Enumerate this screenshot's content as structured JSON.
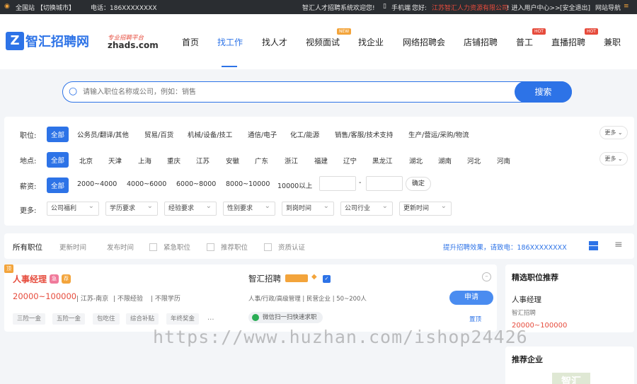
{
  "topbar": {
    "site": "全国站",
    "switch": "【切换城市】",
    "phone": "电话：186XXXXXXXX",
    "welcome": "智汇人才招聘系统欢迎您!",
    "mobile": "手机端",
    "hello": "您好:",
    "company": "江苏智汇人力资源有限公司",
    "enter": "! 进入用户中心>>",
    "logout": "[安全退出]",
    "sitenav": "网站导航"
  },
  "logo": {
    "main": "智汇招聘网",
    "slogan": "专业招聘平台",
    "domain": "zhads.com"
  },
  "nav": {
    "items": [
      "首页",
      "找工作",
      "找人才",
      "视频面试",
      "找企业",
      "网络招聘会",
      "店铺招聘",
      "普工",
      "直播招聘",
      "兼职"
    ],
    "new_badge": "NEW",
    "hot_badge": "HOT"
  },
  "search": {
    "placeholder": "请输入职位名称或公司，例如：销售",
    "button": "搜索"
  },
  "filters": {
    "job_label": "职位:",
    "all": "全部",
    "jobs": [
      "公务员/翻译/其他",
      "贸易/百货",
      "机械/设备/技工",
      "通信/电子",
      "化工/能源",
      "销售/客服/技术支持",
      "生产/营运/采购/物流"
    ],
    "more": "更多",
    "area_label": "地点:",
    "areas": [
      "北京",
      "天津",
      "上海",
      "重庆",
      "江苏",
      "安徽",
      "广东",
      "浙江",
      "福建",
      "辽宁",
      "黑龙江",
      "湖北",
      "湖南",
      "河北",
      "河南"
    ],
    "salary_label": "薪资:",
    "salaries": [
      "2000~4000",
      "4000~6000",
      "6000~8000",
      "8000~10000",
      "10000以上"
    ],
    "dash": "-",
    "confirm": "确定",
    "more_label": "更多:",
    "selects": [
      "公司福利",
      "学历要求",
      "经验要求",
      "性别要求",
      "到岗时间",
      "公司行业",
      "更新时间"
    ]
  },
  "tabs": {
    "all": "所有职位",
    "update": "更新时间",
    "publish": "发布时间",
    "urgent": "紧急职位",
    "recommend": "推荐职位",
    "verified": "资质认证",
    "promo": "提升招聘效果，请致电：186XXXXXXXX"
  },
  "job": {
    "corner": "顶",
    "title": "人事经理",
    "salary": "20000~100000",
    "location": "江苏-南京",
    "exp": "不限经验",
    "edu": "不限学历",
    "tags": [
      "三险一金",
      "五险一金",
      "包吃住",
      "综合补贴",
      "年终奖金"
    ],
    "ellipsis": "...",
    "company": "智汇招聘",
    "company_meta": "人事/行政/高级管理 | 民营企业 | 50~200人",
    "wechat": "微信扫一扫快速求职",
    "apply": "申请",
    "top": "置顶",
    "badge_urgent": "急",
    "badge_rec": "荐"
  },
  "side": {
    "title1": "精选职位推荐",
    "job": "人事经理",
    "company": "智汇招聘",
    "salary": "20000~100000",
    "title2": "推荐企业",
    "logo_text": "智汇"
  },
  "watermark": "https://www.huzhan.com/ishop24426"
}
